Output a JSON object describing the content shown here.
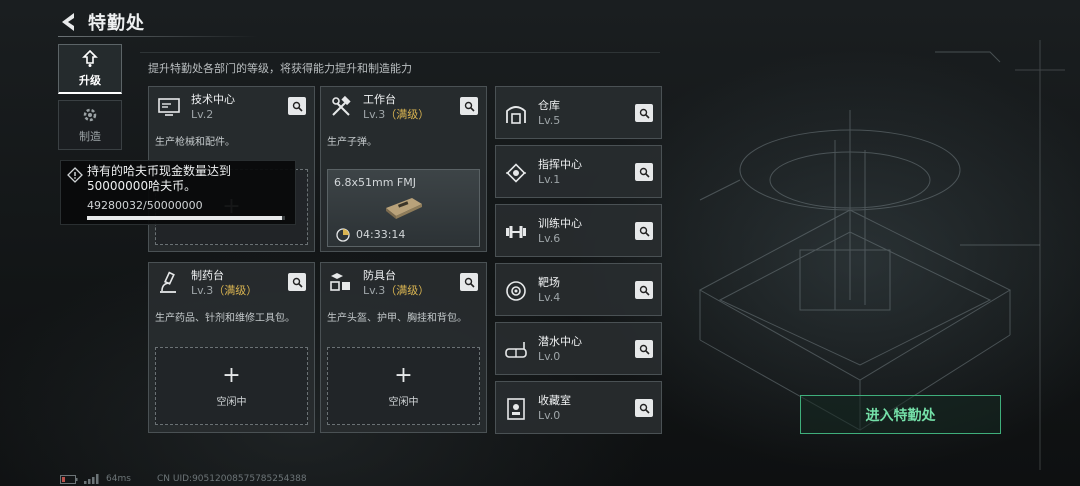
{
  "header": {
    "title": "特勤处",
    "subtitle": "提升特勤处各部门的等级，将获得能力提升和制造能力"
  },
  "nav": {
    "tabs": [
      {
        "label": "升级"
      },
      {
        "label": "制造"
      }
    ]
  },
  "workshops": [
    {
      "name": "技术中心",
      "level": "Lv.2",
      "max": "",
      "desc": "生产枪械和配件。"
    },
    {
      "name": "工作台",
      "level": "Lv.3",
      "max": "（满级）",
      "desc": "生产子弹。",
      "crafting": {
        "item": "6.8x51mm FMJ",
        "time": "04:33:14"
      }
    },
    {
      "name": "制药台",
      "level": "Lv.3",
      "max": "（满级）",
      "desc": "生产药品、针剂和维修工具包。",
      "slot_label": "空闲中"
    },
    {
      "name": "防具台",
      "level": "Lv.3",
      "max": "（满级）",
      "desc": "生产头盔、护甲、胸挂和背包。",
      "slot_label": "空闲中"
    }
  ],
  "rooms": [
    {
      "name": "仓库",
      "level": "Lv.5"
    },
    {
      "name": "指挥中心",
      "level": "Lv.1"
    },
    {
      "name": "训练中心",
      "level": "Lv.6"
    },
    {
      "name": "靶场",
      "level": "Lv.4"
    },
    {
      "name": "潜水中心",
      "level": "Lv.0"
    },
    {
      "name": "收藏室",
      "level": "Lv.0"
    }
  ],
  "tooltip": {
    "line1": "持有的哈夫币现金数量达到",
    "line2": "50000000哈夫币。",
    "progress": "49280032/50000000",
    "fraction": 0.9856
  },
  "enter_button": "进入特勤处",
  "status": {
    "ping": "64ms",
    "uid": "CN UID:9051200857578525438​8"
  }
}
